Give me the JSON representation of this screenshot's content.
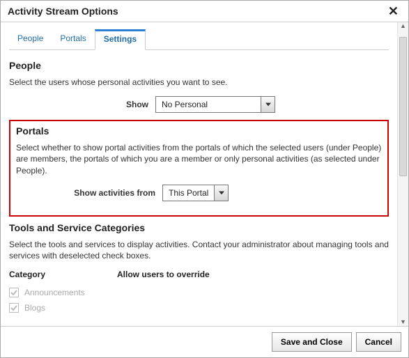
{
  "dialog": {
    "title": "Activity Stream Options"
  },
  "tabs": {
    "people": "People",
    "portals": "Portals",
    "settings": "Settings",
    "active": "settings"
  },
  "people_section": {
    "title": "People",
    "desc": "Select the users whose personal activities you want to see.",
    "show_label": "Show",
    "show_value": "No Personal"
  },
  "portals_section": {
    "title": "Portals",
    "desc": "Select whether to show portal activities from the portals of which the selected users (under People) are members, the portals of which you are a member or only personal activities (as selected under People).",
    "from_label": "Show activities from",
    "from_value": "This Portal"
  },
  "tools_section": {
    "title": "Tools and Service Categories",
    "desc": "Select the tools and services to display activities. Contact your administrator about managing tools and services with deselected check boxes.",
    "col_category": "Category",
    "col_override": "Allow users to override",
    "items": [
      {
        "label": "Announcements",
        "checked": true,
        "disabled": true
      },
      {
        "label": "Blogs",
        "checked": true,
        "disabled": true
      }
    ]
  },
  "buttons": {
    "save_close": "Save and Close",
    "cancel": "Cancel"
  }
}
